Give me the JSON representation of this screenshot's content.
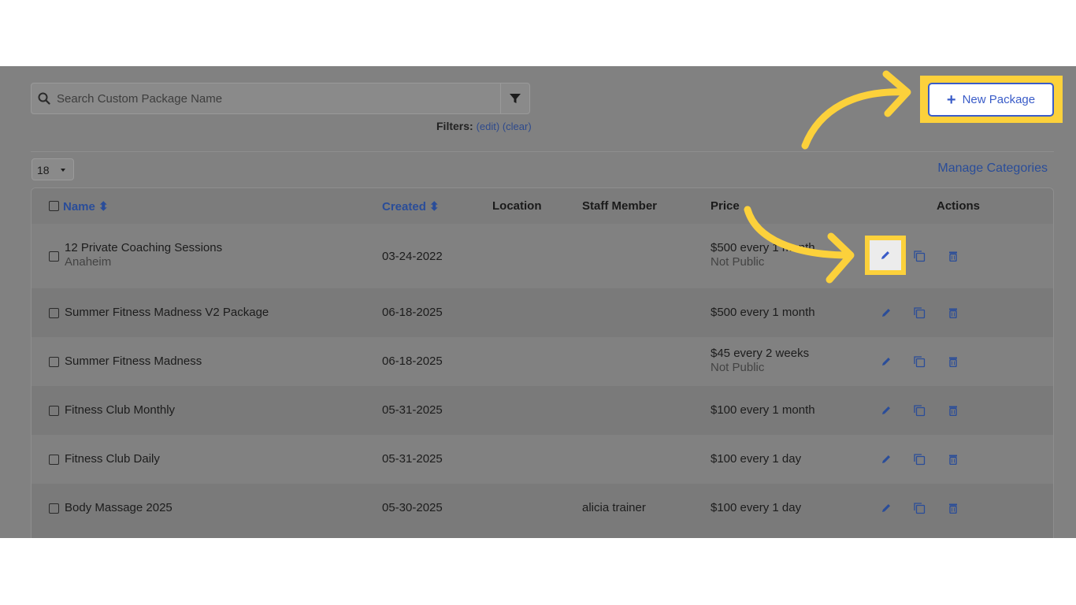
{
  "search": {
    "placeholder": "Search Custom Package Name"
  },
  "filters": {
    "label": "Filters:",
    "open1": "(",
    "edit": "edit",
    "mid": ") (",
    "clear": "clear",
    "close": ")"
  },
  "page_size": {
    "value": "18"
  },
  "manage_categories": "Manage Categories",
  "new_package": {
    "label": "New Package",
    "plus": "+"
  },
  "table": {
    "headers": {
      "name": "Name",
      "created": "Created",
      "location": "Location",
      "staff": "Staff Member",
      "price": "Price",
      "actions": "Actions"
    },
    "sort_glyph": "⬍",
    "rows": [
      {
        "name": "12 Private Coaching Sessions",
        "sub": "Anaheim",
        "created": "03-24-2022",
        "staff": "",
        "price": "$500 every 1 month",
        "price_sub": "Not Public"
      },
      {
        "name": "Summer Fitness Madness V2 Package",
        "sub": "",
        "created": "06-18-2025",
        "staff": "",
        "price": "$500 every 1 month",
        "price_sub": ""
      },
      {
        "name": "Summer Fitness Madness",
        "sub": "",
        "created": "06-18-2025",
        "staff": "",
        "price": "$45 every 2 weeks",
        "price_sub": "Not Public"
      },
      {
        "name": "Fitness Club Monthly",
        "sub": "",
        "created": "05-31-2025",
        "staff": "",
        "price": "$100 every 1 month",
        "price_sub": ""
      },
      {
        "name": "Fitness Club Daily",
        "sub": "",
        "created": "05-31-2025",
        "staff": "",
        "price": "$100 every 1 day",
        "price_sub": ""
      },
      {
        "name": "Body Massage 2025",
        "sub": "",
        "created": "05-30-2025",
        "staff": "alicia trainer",
        "price": "$100 every 1 day",
        "price_sub": ""
      }
    ]
  },
  "colors": {
    "accent": "#3a5cc8",
    "highlight": "#fcd13b",
    "overlay": "#818181"
  }
}
